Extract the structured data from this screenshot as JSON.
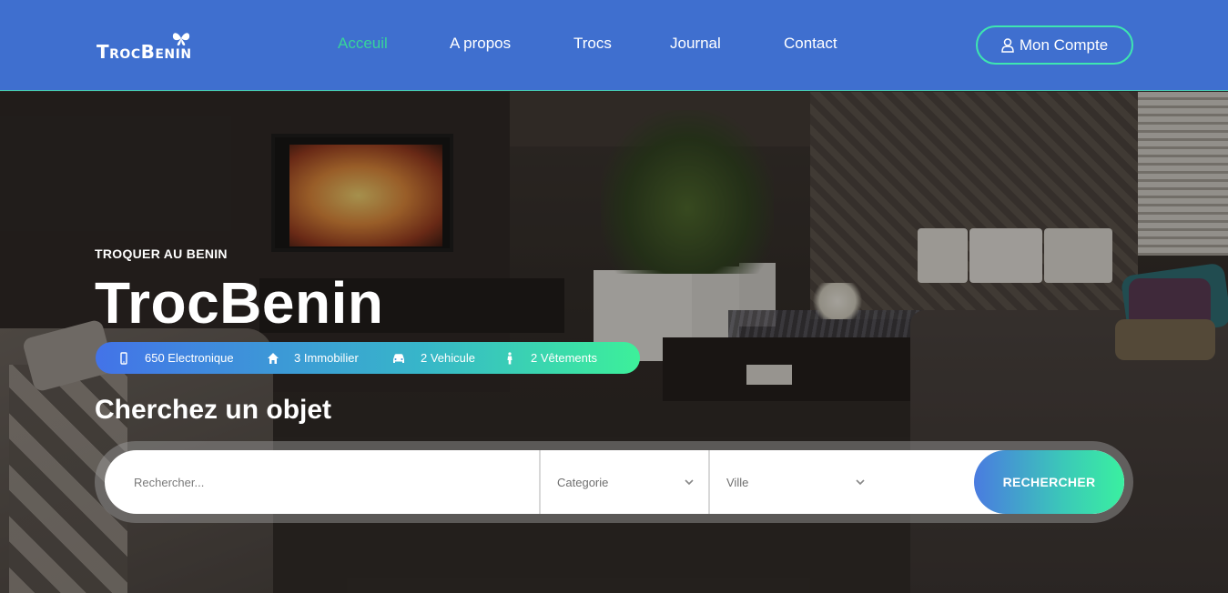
{
  "header": {
    "logo_text": "TrocBenin",
    "nav": [
      {
        "label": "Acceuil",
        "active": true
      },
      {
        "label": "A propos",
        "active": false
      },
      {
        "label": "Trocs",
        "active": false
      },
      {
        "label": "Journal",
        "active": false
      },
      {
        "label": "Contact",
        "active": false
      }
    ],
    "account_label": "Mon Compte",
    "account_icon": "user-icon"
  },
  "hero": {
    "eyebrow": "TROQUER AU BENIN",
    "title": "TrocBenin",
    "categories": [
      {
        "icon": "mobile-icon",
        "label": "650 Electronique"
      },
      {
        "icon": "home-icon",
        "label": "3 Immobilier"
      },
      {
        "icon": "car-icon",
        "label": "2 Vehicule"
      },
      {
        "icon": "person-icon",
        "label": "2 Vêtements"
      }
    ],
    "search_heading": "Cherchez un objet"
  },
  "search": {
    "placeholder": "Rechercher...",
    "category_selected": "Categorie",
    "city_selected": "Ville",
    "button_label": "RECHERCHER"
  },
  "colors": {
    "header_bg": "#3f6fcf",
    "nav_active": "#37d39a",
    "accent_start": "#4373e8",
    "accent_end": "#3df09a"
  }
}
